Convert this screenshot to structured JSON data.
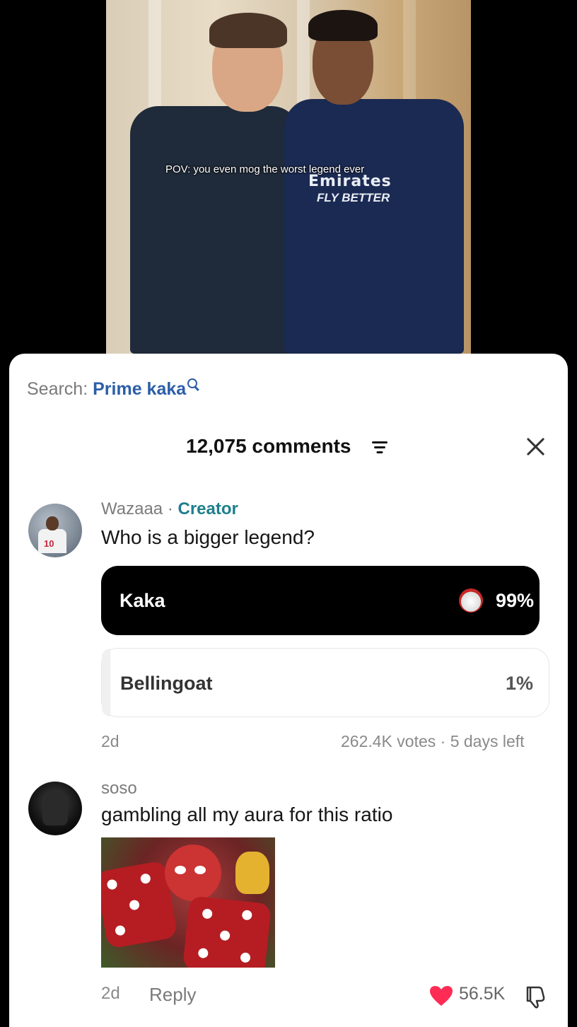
{
  "video": {
    "caption": "POV: you even mog the worst legend ever",
    "sponsor_line1": "Emirates",
    "sponsor_line2": "FLY BETTER"
  },
  "search": {
    "prefix": "Search:",
    "term": "Prime kaka"
  },
  "comments_header": {
    "count_label": "12,075 comments"
  },
  "comments": [
    {
      "username": "Wazaaa",
      "separator": " · ",
      "badge": "Creator",
      "text": "Who is a bigger legend?",
      "poll": {
        "options": [
          {
            "label": "Kaka",
            "percent": "99%",
            "percent_value": 99,
            "selected": true
          },
          {
            "label": "Bellingoat",
            "percent": "1%",
            "percent_value": 1,
            "selected": false
          }
        ],
        "age": "2d",
        "votes_info": "262.4K votes · 5 days left"
      }
    },
    {
      "username": "soso",
      "text": "gambling all my aura for this ratio",
      "age": "2d",
      "reply_label": "Reply",
      "likes": "56.5K"
    }
  ],
  "colors": {
    "accent": "#2c5ea8",
    "creator": "#1e7f8c",
    "like": "#fe2c55"
  }
}
